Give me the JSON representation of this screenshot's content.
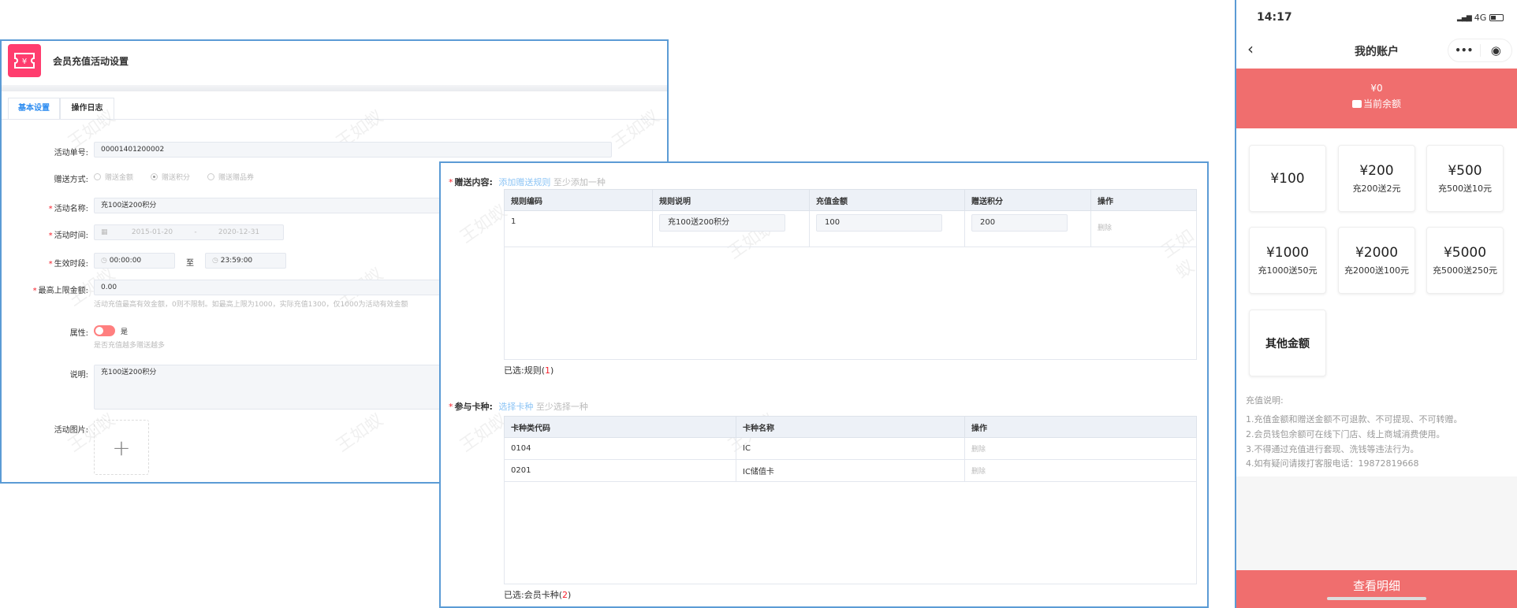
{
  "watermark": "王如蚁",
  "admin": {
    "title": "会员充值活动设置",
    "tabs": [
      {
        "label": "基本设置",
        "active": true
      },
      {
        "label": "操作日志",
        "active": false
      }
    ],
    "fields": {
      "order_no": {
        "label": "活动单号:",
        "value": "00001401200002"
      },
      "gift_mode": {
        "label": "赠送方式:",
        "options": [
          "赠送金额",
          "赠送积分",
          "赠送赠品券"
        ],
        "selected": "赠送积分"
      },
      "name": {
        "label": "活动名称:",
        "value": "充100送200积分"
      },
      "time": {
        "label": "活动时间:",
        "start": "2015-01-20",
        "sep": "-",
        "end": "2020-12-31"
      },
      "period": {
        "label": "生效时段:",
        "start": "00:00:00",
        "to": "至",
        "end": "23:59:00"
      },
      "max_amount": {
        "label": "最高上限金额:",
        "value": "0.00",
        "hint": "活动充值最高有效金额，0则不限制。如最高上限为1000，实际充值1300，仅1000为活动有效金额"
      },
      "attribute": {
        "label": "属性:",
        "toggle_on": true,
        "toggle_label": "是",
        "hint": "是否充值越多赠送越多"
      },
      "desc": {
        "label": "说明:",
        "value": "充100送200积分"
      },
      "image": {
        "label": "活动图片:",
        "add": "+"
      }
    }
  },
  "gift": {
    "label": "赠送内容:",
    "link": "添加赠送规则",
    "hint": "至少添加一种",
    "columns": [
      "规则编码",
      "规则说明",
      "充值金额",
      "赠送积分",
      "操作"
    ],
    "rows": [
      {
        "code": "1",
        "desc": "充100送200积分",
        "amount": "100",
        "points": "200",
        "action": "删除"
      }
    ],
    "selected_prefix": "已选:规则(",
    "selected_count": "1",
    "selected_suffix": ")"
  },
  "cards": {
    "label": "参与卡种:",
    "link": "选择卡种",
    "hint": "至少选择一种",
    "columns": [
      "卡种类代码",
      "卡种名称",
      "操作"
    ],
    "rows": [
      {
        "code": "0104",
        "name": "IC",
        "action": "删除"
      },
      {
        "code": "0201",
        "name": "IC储值卡",
        "action": "删除"
      }
    ],
    "selected_prefix": "已选:会员卡种(",
    "selected_count": "2",
    "selected_suffix": ")"
  },
  "phone": {
    "time": "14:17",
    "network": "4G",
    "title": "我的账户",
    "balance": "¥0",
    "balance_label": "当前余额",
    "options": [
      {
        "amount": "¥100",
        "sub": ""
      },
      {
        "amount": "¥200",
        "sub": "充200送2元"
      },
      {
        "amount": "¥500",
        "sub": "充500送10元"
      },
      {
        "amount": "¥1000",
        "sub": "充1000送50元"
      },
      {
        "amount": "¥2000",
        "sub": "充2000送100元"
      },
      {
        "amount": "¥5000",
        "sub": "充5000送250元"
      },
      {
        "amount": "其他金额",
        "sub": ""
      }
    ],
    "notes_title": "充值说明:",
    "notes": [
      "1.充值金额和赠送金额不可退款、不可提现、不可转赠。",
      "2.会员钱包余额可在线下门店、线上商城消费使用。",
      "3.不得通过充值进行套现、洗钱等违法行为。",
      "4.如有疑问请拨打客服电话：19872819668"
    ],
    "detail_button": "查看明细"
  },
  "colors": {
    "accent": "#f06e6e",
    "link": "#8cc4f5",
    "border": "#5b9bd5",
    "logo": "#ff3d6e"
  }
}
